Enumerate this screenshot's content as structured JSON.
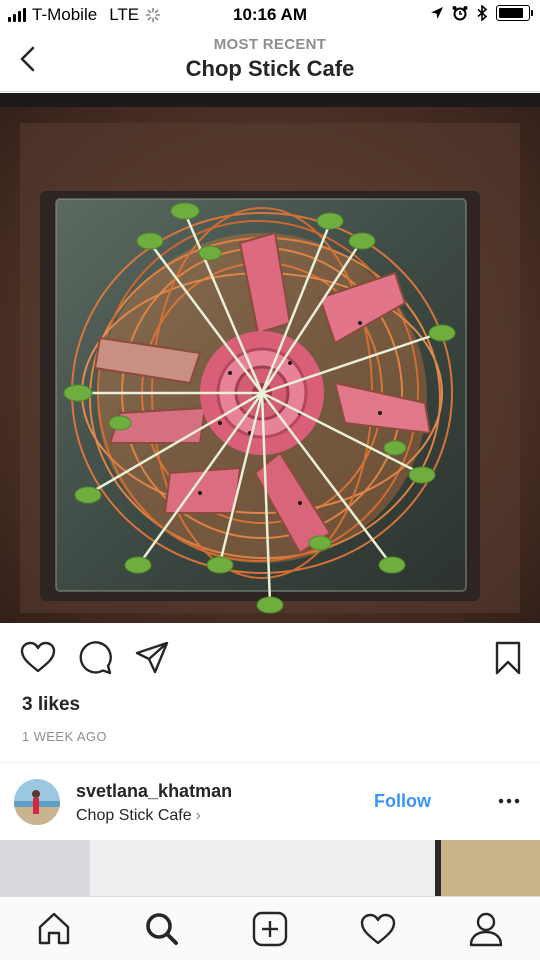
{
  "status_bar": {
    "carrier": "T-Mobile",
    "network": "LTE",
    "time": "10:16 AM",
    "battery_level": 0.85
  },
  "header": {
    "subtitle": "MOST RECENT",
    "title": "Chop Stick Cafe",
    "back_icon": "chevron-left-icon"
  },
  "post": {
    "image_alt": "Seared tuna rose plated on shredded carrots with microgreens",
    "likes": "3 likes",
    "time_ago": "1 WEEK AGO",
    "actions": [
      "heart-icon",
      "comment-icon",
      "share-icon",
      "bookmark-icon"
    ]
  },
  "account": {
    "username": "svetlana_khatman",
    "location": "Chop Stick Cafe",
    "location_chevron": "›",
    "follow_label": "Follow",
    "more_icon": "more-dots-icon"
  },
  "tab_bar": {
    "tabs": [
      "home-icon",
      "search-icon",
      "add-post-icon",
      "activity-heart-icon",
      "profile-icon"
    ],
    "active": "search-icon"
  },
  "colors": {
    "accent_blue": "#3897f0",
    "text_primary": "#262626",
    "text_secondary": "#8e8e8e",
    "divider": "#dbdbdb"
  }
}
